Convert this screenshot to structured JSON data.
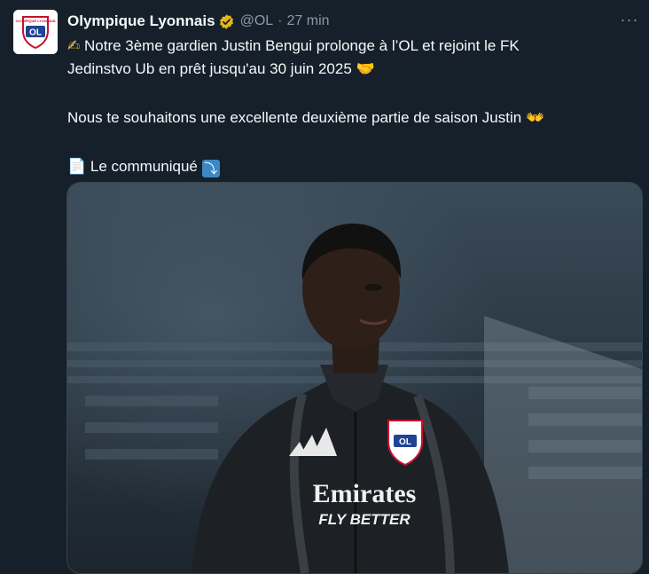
{
  "tweet": {
    "author_name": "Olympique Lyonnais",
    "handle": "@OL",
    "separator": "·",
    "time": "27 min",
    "more_label": "···",
    "avatar_label": "OL",
    "avatar_top_text": "OLYMPIQUE LYONNAIS",
    "lines": {
      "l1": "Notre 3ème gardien Justin Bengui prolonge à l’OL et rejoint le FK",
      "l2": "Jedinstvo Ub en prêt jusqu'au 30 juin 2025",
      "l3": "Nous te souhaitons une excellente deuxième partie de saison Justin",
      "l4": "Le communiqué"
    },
    "emojis": {
      "writing": "✍",
      "handshake": "🤝",
      "hands": "👐",
      "document": "📄",
      "arrow": "⤵"
    }
  },
  "media": {
    "jersey_sponsor": "Emirates",
    "jersey_tagline": "FLY BETTER",
    "badge_text": "OL"
  },
  "colors": {
    "background": "#15202b",
    "text": "#f7f9f9",
    "muted": "#8b98a5",
    "verified": "#e2b719",
    "arrow_emoji_bg": "#3b88c3"
  }
}
